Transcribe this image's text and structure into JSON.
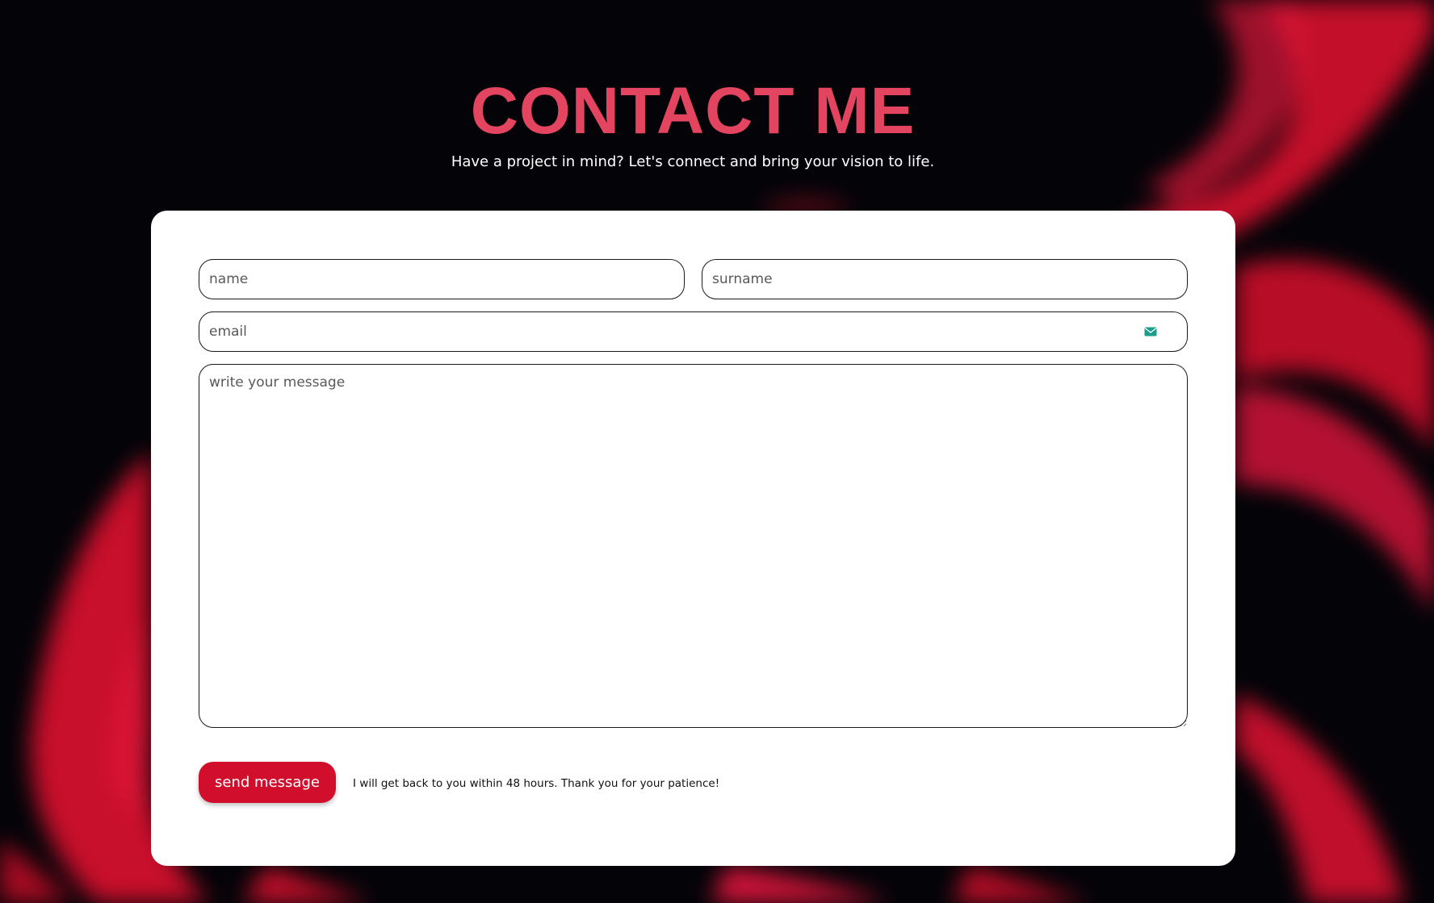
{
  "header": {
    "title": "CONTACT ME",
    "subtitle": "Have a project in mind? Let's connect and bring your vision to life."
  },
  "form": {
    "name_placeholder": "name",
    "surname_placeholder": "surname",
    "email_placeholder": "email",
    "message_placeholder": "write your message",
    "email_icon": "mail-icon",
    "send_label": "send message",
    "note": "I will get back to you within 48 hours. Thank you for your patience!"
  },
  "colors": {
    "background": "#040408",
    "accent": "#d10f2c",
    "title": "#e3445f",
    "card": "#ffffff",
    "mail_icon": "#1a9e8c"
  }
}
